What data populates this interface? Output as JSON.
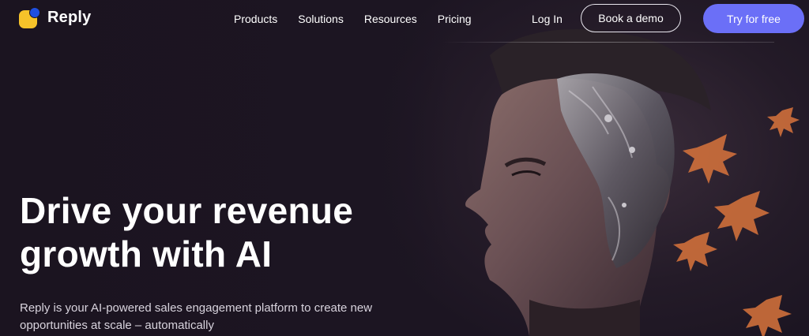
{
  "header": {
    "logo_text": "Reply",
    "nav": [
      {
        "label": "Products"
      },
      {
        "label": "Solutions"
      },
      {
        "label": "Resources"
      },
      {
        "label": "Pricing"
      }
    ],
    "login_label": "Log In",
    "demo_label": "Book a demo",
    "try_label": "Try for free"
  },
  "hero": {
    "title_line1": "Drive your revenue",
    "title_line2": "growth with AI",
    "subtitle_line1": "Reply is your AI-powered sales engagement platform to create new",
    "subtitle_line2": "opportunities at scale – automatically"
  },
  "colors": {
    "background": "#1b1420",
    "accent": "#6b6ff7",
    "logo_yellow": "#f6c32a",
    "logo_blue": "#1f4fe0"
  },
  "icons": {
    "logo": "reply-logo-icon"
  }
}
